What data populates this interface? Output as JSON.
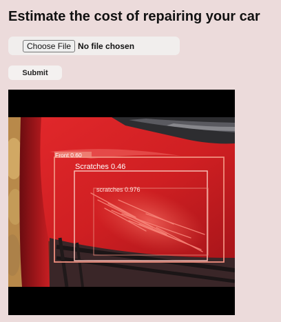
{
  "page": {
    "title": "Estimate the cost of repairing your car"
  },
  "upload": {
    "choose_label": "Choose File",
    "status": "No file chosen"
  },
  "form": {
    "submit_label": "Submit"
  },
  "detections": [
    {
      "label": "Front 0.60",
      "color": "#f08f7f"
    },
    {
      "label": "Scratches 0.46",
      "color": "#f7bdb5"
    },
    {
      "label": "scratches 0.976",
      "color": "#e98a7c"
    }
  ]
}
